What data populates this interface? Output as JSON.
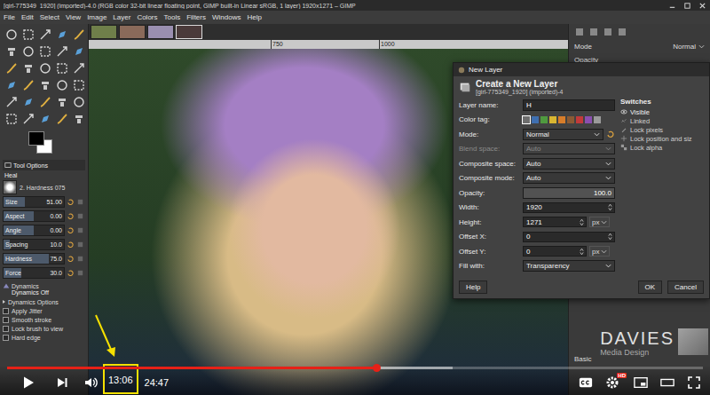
{
  "gimp": {
    "title": "[girl-775349_1920] (imported)-4.0 (RGB color 32-bit linear floating point, GIMP built-in Linear sRGB, 1 layer) 1920x1271 – GIMP",
    "menu": [
      "File",
      "Edit",
      "Select",
      "View",
      "Image",
      "Layer",
      "Colors",
      "Tools",
      "Filters",
      "Windows",
      "Help"
    ],
    "image_tabs": [
      {
        "color": "#6f7f4a",
        "selected": false
      },
      {
        "color": "#8a6a5a",
        "selected": false
      },
      {
        "color": "#9a8fb0",
        "selected": false
      },
      {
        "color": "#4a3a3a",
        "selected": true
      }
    ],
    "ruler": [
      "750",
      "1000"
    ],
    "tool_options": {
      "tab": "Tool Options",
      "tool": "Heal",
      "brush": "2. Hardness 075",
      "sliders": [
        {
          "label": "Size",
          "value": "51.00",
          "level": 0.35
        },
        {
          "label": "Aspect",
          "value": "0.00",
          "level": 0.5
        },
        {
          "label": "Angle",
          "value": "0.00",
          "level": 0.5
        },
        {
          "label": "Spacing",
          "value": "10.0",
          "level": 0.1
        },
        {
          "label": "Hardness",
          "value": "75.0",
          "level": 0.75
        },
        {
          "label": "Force",
          "value": "30.0",
          "level": 0.3
        }
      ],
      "dynamics": {
        "label": "Dynamics",
        "value": "Dynamics Off"
      },
      "dynamics_options": {
        "label": "Dynamics Options",
        "expanded": false
      },
      "options": [
        {
          "label": "Apply Jitter",
          "checked": false
        },
        {
          "label": "Smooth stroke",
          "checked": false
        },
        {
          "label": "Lock brush to view",
          "checked": false
        },
        {
          "label": "Hard edge",
          "checked": false
        }
      ]
    },
    "layers_panel": {
      "mode_label": "Mode",
      "mode": "Normal",
      "opacity_label": "Opacity",
      "tab": "Basic"
    }
  },
  "dialog": {
    "title": "New Layer",
    "heading": "Create a New Layer",
    "subheading": "[girl-775349_1920] (imported)-4",
    "fields": [
      {
        "kind": "text",
        "label": "Layer name:",
        "value": "H"
      },
      {
        "kind": "tags",
        "label": "Color tag:",
        "tags": [
          {
            "color": "#6e6e6e",
            "selected": true
          },
          {
            "color": "#3f6fb0",
            "selected": false
          },
          {
            "color": "#4f9a3f",
            "selected": false
          },
          {
            "color": "#d8b531",
            "selected": false
          },
          {
            "color": "#d77d2a",
            "selected": false
          },
          {
            "color": "#8a5a34",
            "selected": false
          },
          {
            "color": "#c23a3a",
            "selected": false
          },
          {
            "color": "#8a4fb0",
            "selected": false
          },
          {
            "color": "#9a9a9a",
            "selected": false
          }
        ]
      },
      {
        "kind": "mode",
        "label": "Mode:",
        "value": "Normal",
        "disabled": false
      },
      {
        "kind": "select",
        "label": "Blend space:",
        "value": "Auto",
        "disabled": true
      },
      {
        "kind": "select",
        "label": "Composite space:",
        "value": "Auto",
        "disabled": false
      },
      {
        "kind": "select",
        "label": "Composite mode:",
        "value": "Auto",
        "disabled": false
      },
      {
        "kind": "slider",
        "label": "Opacity:",
        "value": "100.0",
        "level": 1
      },
      {
        "kind": "spin",
        "label": "Width:",
        "value": "1920"
      },
      {
        "kind": "spin-unit",
        "label": "Height:",
        "value": "1271",
        "unit": "px"
      },
      {
        "kind": "spin",
        "label": "Offset X:",
        "value": "0"
      },
      {
        "kind": "spin-unit",
        "label": "Offset Y:",
        "value": "0",
        "unit": "px"
      },
      {
        "kind": "select",
        "label": "Fill with:",
        "value": "Transparency",
        "disabled": false
      }
    ],
    "switches_title": "Switches",
    "switches": [
      {
        "label": "Visible",
        "checked": true
      },
      {
        "label": "Linked",
        "checked": false
      },
      {
        "label": "Lock pixels",
        "checked": false
      },
      {
        "label": "Lock position and siz",
        "checked": false
      },
      {
        "label": "Lock alpha",
        "checked": false
      }
    ],
    "buttons": [
      "Help",
      "OK",
      "Cancel"
    ]
  },
  "watermark": {
    "brand": "DAVIES",
    "sub": "Media Design"
  },
  "player": {
    "progress": 0.53,
    "buffered": 0.64,
    "current": "13:06",
    "duration": "24:47",
    "quality_badge": "HD"
  }
}
